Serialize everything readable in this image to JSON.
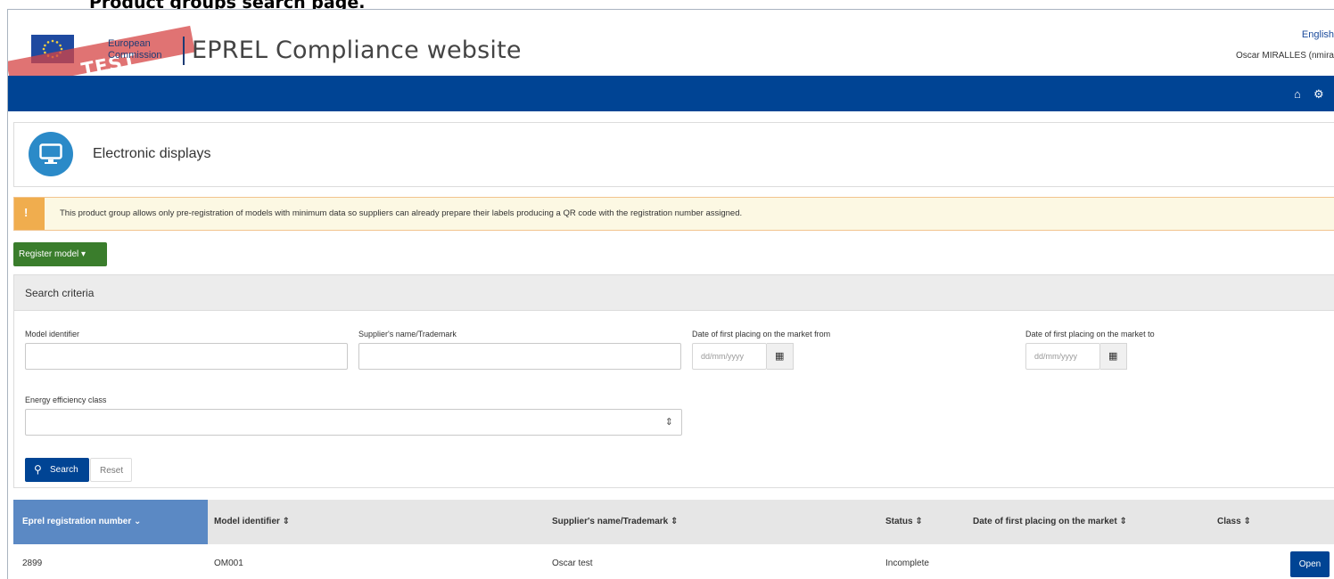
{
  "caption": "Product groups search page.",
  "header": {
    "test_badge": "TEST",
    "ec_line1": "European",
    "ec_line2": "Commission",
    "site_title": "EPREL Compliance website",
    "language": "English",
    "user": "Oscar MIRALLES (nmira"
  },
  "navbar": {
    "icons": [
      "home-icon",
      "gear-icon"
    ],
    "home_glyph": "⌂",
    "gear_glyph": "⚙"
  },
  "product_group": {
    "title": "Electronic displays",
    "icon": "monitor-icon"
  },
  "alert": {
    "icon": "warning-icon",
    "glyph": "!",
    "text": "This product group allows only pre-registration of models with minimum data so suppliers can already prepare their labels producing a QR code with the registration number assigned."
  },
  "register_button": "Register model ▾",
  "search": {
    "title": "Search criteria",
    "model_identifier_label": "Model identifier",
    "model_identifier_value": "",
    "supplier_label": "Supplier's name/Trademark",
    "supplier_value": "",
    "date_from_label": "Date of first placing on the market from",
    "date_from_placeholder": "dd/mm/yyyy",
    "date_to_label": "Date of first placing on the market to",
    "date_to_placeholder": "dd/mm/yyyy",
    "calendar_glyph": "▦",
    "energy_class_label": "Energy efficiency class",
    "energy_class_value": "",
    "select_glyph": "⇕",
    "search_button": "Search",
    "search_glyph": "⚲",
    "reset_button": "Reset"
  },
  "table": {
    "columns": [
      "Eprel registration number  ⌄",
      "Model identifier  ⇕",
      "Supplier's name/Trademark  ⇕",
      "Status  ⇕",
      "Date of first placing on the market  ⇕",
      "Class  ⇕"
    ],
    "rows": [
      {
        "registration_number": "2899",
        "model_identifier": "OM001",
        "supplier": "Oscar test",
        "status": "Incomplete",
        "date": "",
        "class": "",
        "action": "Open"
      }
    ]
  },
  "colors": {
    "navbar": "#004494",
    "register_button": "#3a7d2c",
    "sorted_header": "#5b89c4",
    "alert_accent": "#f0ad4e",
    "group_icon": "#2b8ac8"
  }
}
